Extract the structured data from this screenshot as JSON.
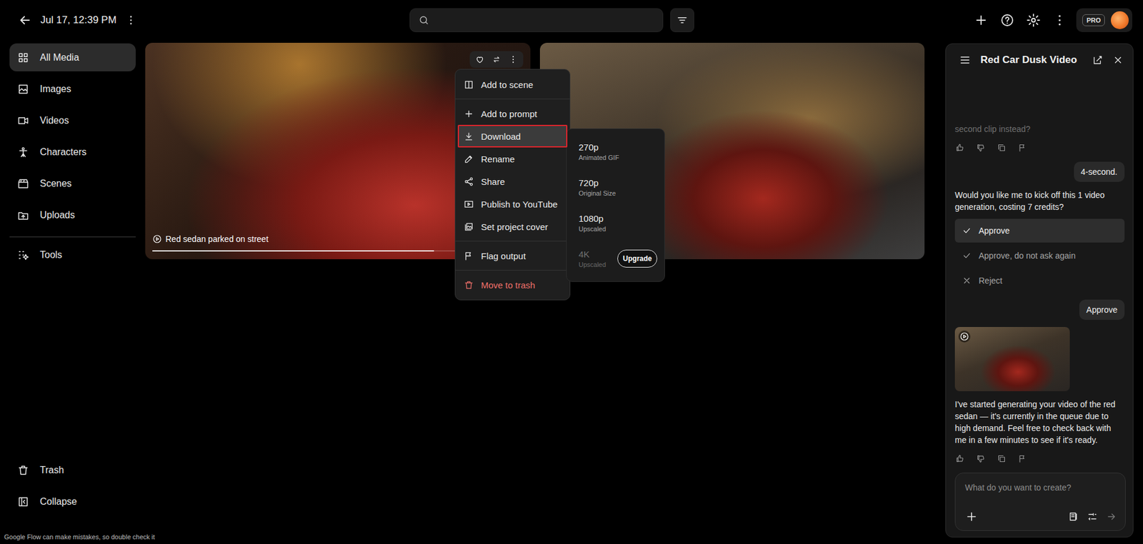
{
  "topbar": {
    "title": "Jul 17, 12:39 PM",
    "plan_badge": "PRO"
  },
  "sidebar": {
    "items": [
      {
        "label": "All Media",
        "selected": true
      },
      {
        "label": "Images",
        "selected": false
      },
      {
        "label": "Videos",
        "selected": false
      },
      {
        "label": "Characters",
        "selected": false
      },
      {
        "label": "Scenes",
        "selected": false
      },
      {
        "label": "Uploads",
        "selected": false
      }
    ],
    "tools": "Tools",
    "bottom": [
      "Trash",
      "Collapse"
    ],
    "disclaimer": "Google Flow can make mistakes, so double check it"
  },
  "media": [
    {
      "kind": "video",
      "caption": "Red sedan parked on street",
      "level": 0.76,
      "hovered": true
    },
    {
      "kind": "image",
      "hovered": false
    }
  ],
  "context_menu": {
    "groups": [
      [
        {
          "label": "Add to scene",
          "selected": false,
          "danger": false
        }
      ],
      [
        {
          "label": "Add to prompt",
          "selected": false,
          "danger": false
        },
        {
          "label": "Download",
          "selected": true,
          "danger": false
        },
        {
          "label": "Rename",
          "selected": false,
          "danger": false
        },
        {
          "label": "Share",
          "selected": false,
          "danger": false
        },
        {
          "label": "Publish to YouTube",
          "selected": false,
          "danger": false
        },
        {
          "label": "Set project cover",
          "selected": false,
          "danger": false
        }
      ],
      [
        {
          "label": "Flag output",
          "selected": false,
          "danger": false
        }
      ],
      [
        {
          "label": "Move to trash",
          "selected": false,
          "danger": true
        }
      ]
    ]
  },
  "download_submenu": [
    {
      "label": "270p",
      "detail": "Animated GIF",
      "disabled": false
    },
    {
      "label": "720p",
      "detail": "Original Size",
      "disabled": false
    },
    {
      "label": "1080p",
      "detail": "Upscaled",
      "disabled": false
    },
    {
      "label": "4K",
      "detail": "Upscaled",
      "disabled": true,
      "button": "Upgrade"
    }
  ],
  "chat": {
    "title": "Red Car Dusk Video",
    "messages": [
      {
        "kind": "assistant",
        "text": "second clip instead?",
        "faded": true,
        "feedback": true
      },
      {
        "kind": "user",
        "text": "4-second."
      },
      {
        "kind": "assistant",
        "text": "Would you like me to kick off this 1 video generation, costing 7 credits?",
        "faded": false,
        "feedback": false,
        "options": [
          {
            "label": "Approve",
            "kind": "accept",
            "selected": true
          },
          {
            "label": "Approve, do not ask again",
            "kind": "accept",
            "selected": false
          },
          {
            "label": "Reject",
            "kind": "reject",
            "selected": false
          }
        ]
      },
      {
        "kind": "user",
        "text": "Approve"
      },
      {
        "kind": "media"
      },
      {
        "kind": "assistant",
        "text": "I've started generating your video of the red sedan — it's currently in the queue due to high demand. Feel free to check back with me in a few minutes to see if it's ready.",
        "faded": false,
        "feedback": true
      }
    ],
    "input": {
      "placeholder": "What do you want to create?"
    }
  }
}
